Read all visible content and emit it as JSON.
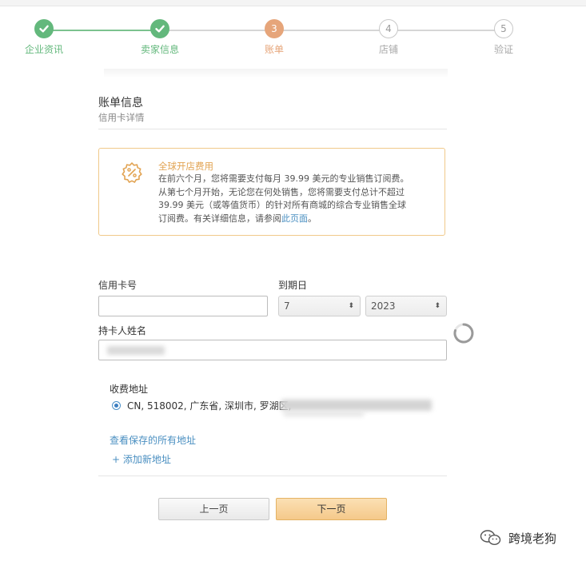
{
  "steps": [
    {
      "label": "企业资讯",
      "marker": "",
      "state": "done"
    },
    {
      "label": "卖家信息",
      "marker": "",
      "state": "done"
    },
    {
      "label": "账单",
      "marker": "3",
      "state": "current"
    },
    {
      "label": "店铺",
      "marker": "4",
      "state": "todo"
    },
    {
      "label": "验证",
      "marker": "5",
      "state": "todo"
    }
  ],
  "colors": {
    "done": "#63b87c",
    "current": "#e6a57a",
    "notice_border": "#f0c98a",
    "link": "#4a8fc1",
    "next_button": "#f5c98a"
  },
  "section": {
    "title": "账单信息",
    "subtitle": "信用卡详情"
  },
  "notice": {
    "icon": "percent-badge-icon",
    "title": "全球开店费用",
    "body_lines": [
      "在前六个月，您将需要支付每月 39.99 美元的专业销售订阅费。",
      "从第七个月开始，无论您在何处销售，您将需要支付总计不超过",
      "39.99 美元（或等值货币）的针对所有商城的综合专业销售全球"
    ],
    "body_last_prefix": "订阅费。有关详细信息，请参阅",
    "link_text": "此页面",
    "body_last_suffix": "。"
  },
  "form": {
    "card_number_label": "信用卡号",
    "card_number_value": "",
    "expiry_label": "到期日",
    "expiry_month": "7",
    "expiry_year": "2023",
    "holder_label": "持卡人姓名"
  },
  "billing": {
    "label": "收费地址",
    "address": "CN, 518002, 广东省, 深圳市, 罗湖区,",
    "view_saved": "查看保存的所有地址",
    "add_new": "+ 添加新地址"
  },
  "buttons": {
    "prev": "上一页",
    "next": "下一页"
  },
  "watermark": {
    "text": "跨境老狗",
    "icon": "wechat-icon"
  }
}
